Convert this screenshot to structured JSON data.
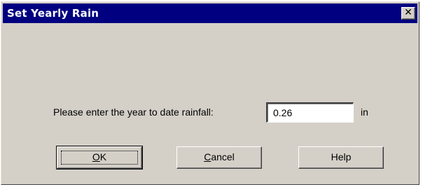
{
  "dialog": {
    "title": "Set Yearly Rain",
    "close_label": "✕",
    "prompt": "Please enter the year to date rainfall:",
    "value": "0.26",
    "unit": "in"
  },
  "buttons": {
    "ok": {
      "mnemonic": "O",
      "rest": "K"
    },
    "cancel": {
      "mnemonic": "C",
      "rest": "ancel"
    },
    "help": "Help"
  },
  "icons": {
    "close": "close-icon"
  }
}
